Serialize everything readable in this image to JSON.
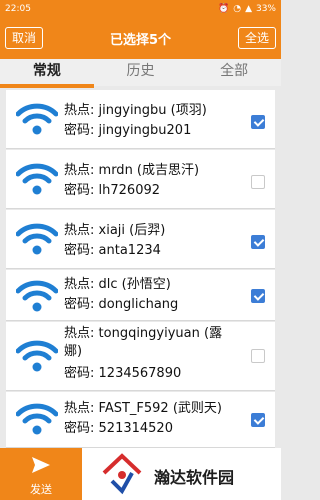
{
  "statusbar": {
    "time": "22:05",
    "battery": "33%"
  },
  "titlebar": {
    "cancel_label": "取消",
    "title": "已选择5个",
    "select_all_label": "全选"
  },
  "tabs": [
    {
      "label": "常规",
      "active": true
    },
    {
      "label": "历史",
      "active": false
    },
    {
      "label": "全部",
      "active": false
    }
  ],
  "hotspots": [
    {
      "hotspot_label": "热点:",
      "ssid": "jingyingbu (项羽)",
      "password_label": "密码:",
      "password": "jingyingbu201",
      "checked": true
    },
    {
      "hotspot_label": "热点:",
      "ssid": "mrdn (成吉思汗)",
      "password_label": "密码:",
      "password": "lh726092",
      "checked": false
    },
    {
      "hotspot_label": "热点:",
      "ssid": "xiaji (后羿)",
      "password_label": "密码:",
      "password": "anta1234",
      "checked": true
    },
    {
      "hotspot_label": "热点:",
      "ssid": "dlc (孙悟空)",
      "password_label": "密码:",
      "password": "donglichang",
      "checked": true
    },
    {
      "hotspot_label": "热点:",
      "ssid_line1": "tongqingyiyuan (露",
      "ssid_line2": "娜)",
      "password_label": "密码:",
      "password": "1234567890",
      "checked": false
    },
    {
      "hotspot_label": "热点:",
      "ssid": "FAST_F592 (武则天)",
      "password_label": "密码:",
      "password": "521314520",
      "checked": true
    }
  ],
  "bottombar": {
    "send_label": "发送",
    "brand_text": "瀚达软件园"
  },
  "colors": {
    "accent": "#f08619",
    "checkbox": "#3c7dd6",
    "wifi_icon": "#1f7fd3"
  }
}
